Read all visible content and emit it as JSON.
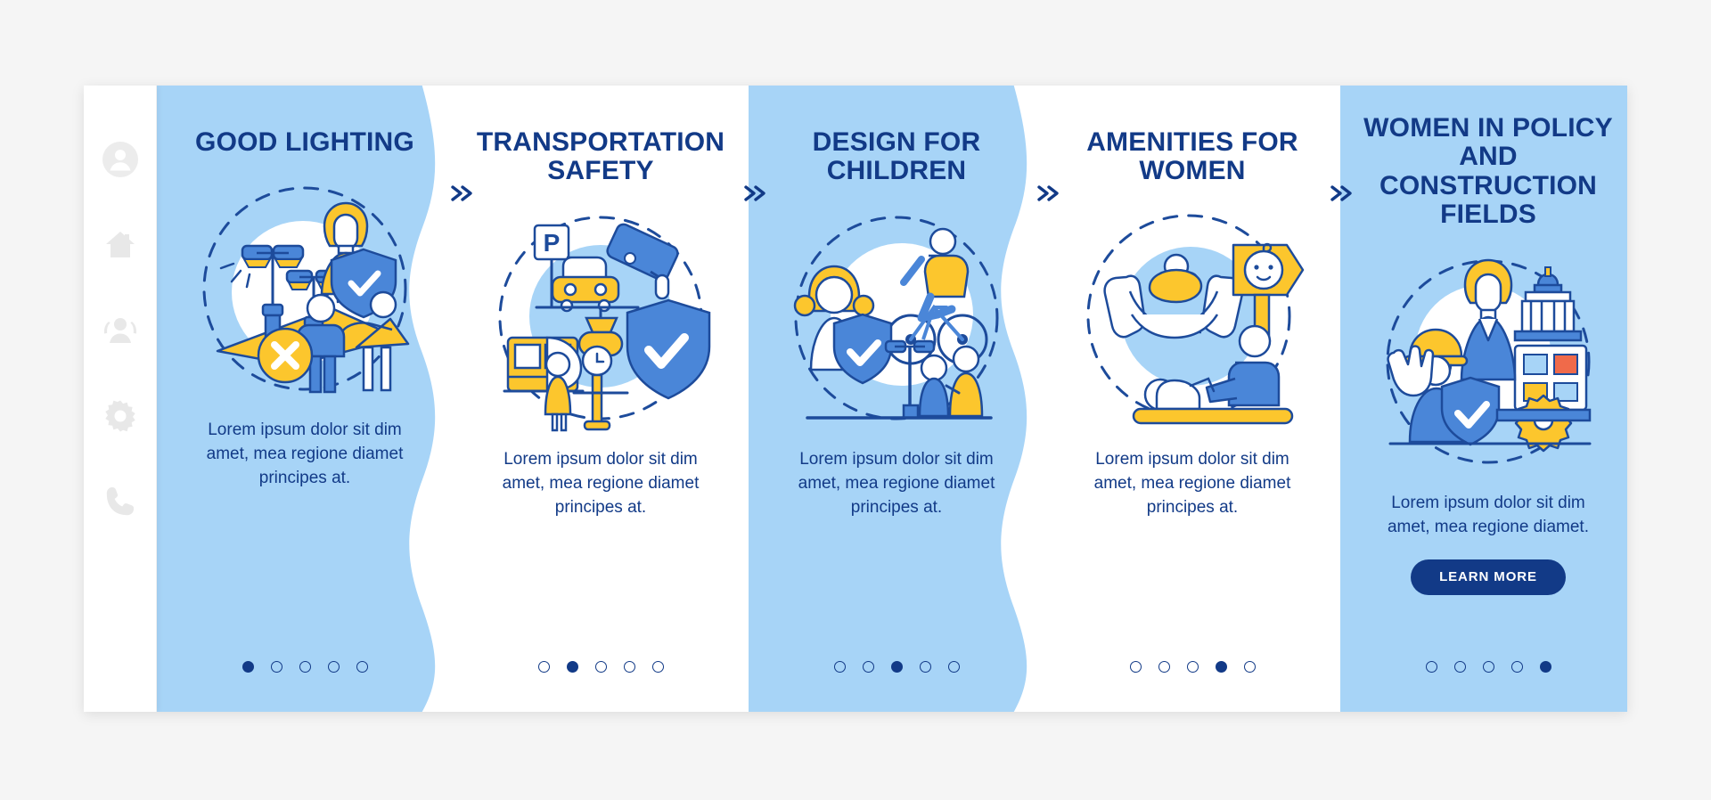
{
  "app": {
    "background_color": "#f5f5f5",
    "frame_background": "#ffffff",
    "accent_blue": "#a7d4f7",
    "navy": "#123a87",
    "yellow": "#fcc62d",
    "mid_blue": "#4a86d8"
  },
  "sidebar": {
    "items": [
      {
        "icon": "user-avatar-icon",
        "label": "Profile"
      },
      {
        "icon": "home-icon",
        "label": "Home"
      },
      {
        "icon": "people-group-icon",
        "label": "Community"
      },
      {
        "icon": "gear-icon",
        "label": "Settings"
      },
      {
        "icon": "phone-icon",
        "label": "Contact"
      }
    ]
  },
  "separator": {
    "glyph": "»",
    "name": "double-chevron-right-icon",
    "count": 4
  },
  "cards": [
    {
      "index": 1,
      "title": "GOOD LIGHTING",
      "body": "Lorem ipsum dolor sit dim amet, mea regione diamet principes at.",
      "background": "#a7d4f7",
      "illustration": "street-lighting-safety-illustration",
      "dots": {
        "total": 5,
        "active": 1
      },
      "has_button": false
    },
    {
      "index": 2,
      "title": "TRANSPORTATION SAFETY",
      "body": "Lorem ipsum dolor sit dim amet, mea regione diamet principes at.",
      "background": "#ffffff",
      "illustration": "transport-cctv-safety-illustration",
      "dots": {
        "total": 5,
        "active": 2
      },
      "has_button": false
    },
    {
      "index": 3,
      "title": "DESIGN FOR CHILDREN",
      "body": "Lorem ipsum dolor sit dim amet, mea regione diamet principes at.",
      "background": "#a7d4f7",
      "illustration": "children-playground-bicycle-illustration",
      "dots": {
        "total": 5,
        "active": 3
      },
      "has_button": false
    },
    {
      "index": 4,
      "title": "AMENITIES FOR WOMEN",
      "body": "Lorem ipsum dolor sit dim amet, mea regione diamet principes at.",
      "background": "#ffffff",
      "illustration": "nursing-room-baby-care-illustration",
      "dots": {
        "total": 5,
        "active": 4
      },
      "has_button": false
    },
    {
      "index": 5,
      "title": "WOMEN IN POLICY AND CONSTRUCTION FIELDS",
      "body": "Lorem ipsum dolor sit dim amet, mea regione diamet.",
      "background": "#a7d4f7",
      "illustration": "women-policy-construction-illustration",
      "dots": {
        "total": 5,
        "active": 5
      },
      "has_button": true,
      "button_label": "LEARN MORE"
    }
  ]
}
